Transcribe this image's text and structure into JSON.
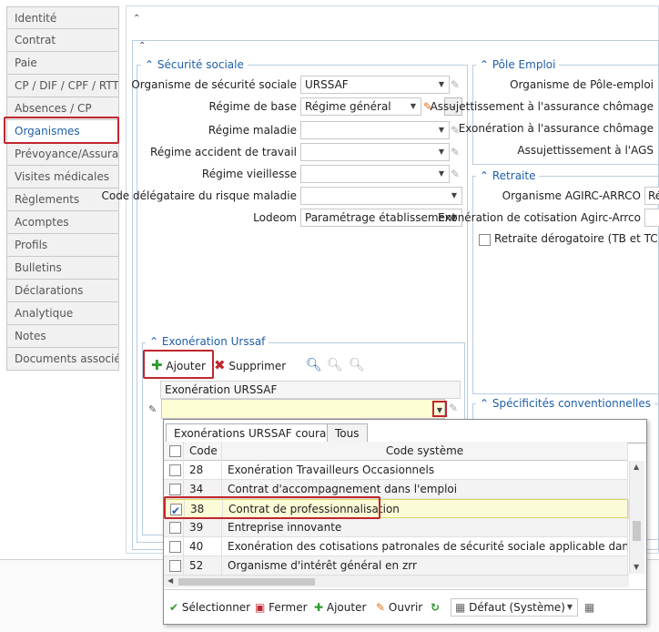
{
  "tabs": [
    {
      "label": "Identité",
      "active": false
    },
    {
      "label": "Contrat",
      "active": false
    },
    {
      "label": "Paie",
      "active": false
    },
    {
      "label": "CP / DIF / CPF / RTT",
      "active": false
    },
    {
      "label": "Absences / CP",
      "active": false
    },
    {
      "label": "Organismes",
      "active": true
    },
    {
      "label": "Prévoyance/Assurance",
      "active": false
    },
    {
      "label": "Visites médicales",
      "active": false
    },
    {
      "label": "Règlements",
      "active": false
    },
    {
      "label": "Acomptes",
      "active": false
    },
    {
      "label": "Profils",
      "active": false
    },
    {
      "label": "Bulletins",
      "active": false
    },
    {
      "label": "Déclarations",
      "active": false
    },
    {
      "label": "Analytique",
      "active": false
    },
    {
      "label": "Notes",
      "active": false
    },
    {
      "label": "Documents associés",
      "active": false
    }
  ],
  "securite": {
    "title": "Sécurité sociale",
    "fields": [
      {
        "label": "Organisme de sécurité sociale",
        "value": "URSSAF"
      },
      {
        "label": "Régime de base",
        "value": "Régime général"
      },
      {
        "label": "Régime maladie",
        "value": ""
      },
      {
        "label": "Régime accident de travail",
        "value": ""
      },
      {
        "label": "Régime vieillesse",
        "value": ""
      },
      {
        "label": "Code délégataire du risque maladie",
        "value": ""
      },
      {
        "label": "Lodeom",
        "value": "Paramétrage établissement"
      }
    ],
    "minus_label": "-"
  },
  "pole": {
    "title": "Pôle Emploi",
    "fields": [
      {
        "label": "Organisme de Pôle-emploi"
      },
      {
        "label": "Assujettissement à l'assurance chômage"
      },
      {
        "label": "Exonération à l'assurance chômage"
      },
      {
        "label": "Assujettissement à l'AGS"
      }
    ]
  },
  "retraite": {
    "title": "Retraite",
    "organisme_label": "Organisme AGIRC-ARRCO",
    "organisme_value": "Ré",
    "exoneration_label": "Exonération de cotisation Agirc-Arrco",
    "derogatoire_label": "Retraite dérogatoire (TB et TC)"
  },
  "specificites": {
    "title": "Spécificités conventionnelles"
  },
  "exoneration": {
    "title": "Exonération Urssaf",
    "add_label": "Ajouter",
    "delete_label": "Supprimer",
    "column_header": "Exonération URSSAF"
  },
  "popup": {
    "tab_current": "Exonérations URSSAF courantes",
    "tab_all": "Tous",
    "col_code": "Code",
    "col_system": "Code système",
    "rows": [
      {
        "code": "28",
        "label": "Exonération Travailleurs Occasionnels",
        "checked": false
      },
      {
        "code": "34",
        "label": "Contrat d'accompagnement dans l'emploi",
        "checked": false
      },
      {
        "code": "38",
        "label": "Contrat de professionnalisation",
        "checked": true
      },
      {
        "code": "39",
        "label": "Entreprise innovante",
        "checked": false
      },
      {
        "code": "40",
        "label": "Exonération des cotisations patronales de sécurité sociale applicable dans les Dom",
        "checked": false
      },
      {
        "code": "52",
        "label": "Organisme d'intérêt général en zrr",
        "checked": false
      }
    ],
    "toolbar": {
      "select": "Sélectionner",
      "close": "Fermer",
      "add": "Ajouter",
      "open": "Ouvrir",
      "default": "Défaut (Système)"
    }
  },
  "colors": {
    "accent": "#1e5fa8",
    "highlight": "#c0262e",
    "selected_row": "#fbfbd7"
  }
}
